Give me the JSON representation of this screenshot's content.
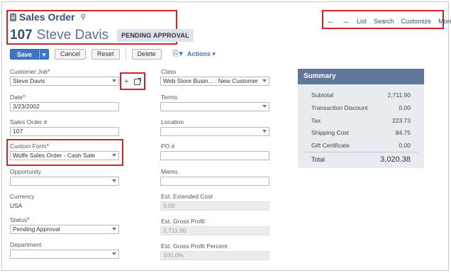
{
  "header": {
    "page_title": "Sales Order",
    "record_number": "107",
    "record_name": "Steve Davis",
    "status_badge": "PENDING APPROVAL"
  },
  "nav": {
    "back_icon": "arrow-left-icon",
    "forward_icon": "arrow-right-icon",
    "list": "List",
    "search": "Search",
    "customize": "Customize",
    "more": "More"
  },
  "toolbar": {
    "save": "Save",
    "cancel": "Cancel",
    "reset": "Reset",
    "delete": "Delete",
    "actions": "Actions"
  },
  "left_fields": {
    "customer_job": {
      "label": "Customer:Job",
      "value": "Steve Davis"
    },
    "date": {
      "label": "Date",
      "value": "3/23/2002"
    },
    "sales_order_num": {
      "label": "Sales Order #",
      "value": "107"
    },
    "custom_form": {
      "label": "Custom Form",
      "value": "Wolfe Sales Order - Cash Sale"
    },
    "opportunity": {
      "label": "Opportunity",
      "value": ""
    },
    "currency": {
      "label": "Currency",
      "value": "USA"
    },
    "status": {
      "label": "Status",
      "value": "Pending Approval"
    },
    "department": {
      "label": "Department",
      "value": ""
    }
  },
  "right_fields": {
    "class": {
      "label": "Class",
      "value": "Web Store Busin... : New Customer"
    },
    "terms": {
      "label": "Terms",
      "value": ""
    },
    "location": {
      "label": "Location",
      "value": ""
    },
    "po_num": {
      "label": "PO #",
      "value": ""
    },
    "memo": {
      "label": "Memo",
      "value": ""
    },
    "est_extended_cost": {
      "label": "Est. Extended Cost",
      "value": "0.00"
    },
    "est_gross_profit": {
      "label": "Est. Gross Profit",
      "value": "2,711.90"
    },
    "est_gross_profit_percent": {
      "label": "Est. Gross Profit Percent",
      "value": "100.0%"
    }
  },
  "summary": {
    "title": "Summary",
    "rows": [
      {
        "label": "Subtotal",
        "value": "2,711.90"
      },
      {
        "label": "Transaction Discount",
        "value": "0.00"
      },
      {
        "label": "Tax",
        "value": "223.73"
      },
      {
        "label": "Shipping Cost",
        "value": "84.75"
      },
      {
        "label": "Gift Certificate",
        "value": "0.00"
      }
    ],
    "total_label": "Total",
    "total_value": "3,020.38"
  },
  "colors": {
    "highlight_border": "#d0242b",
    "accent": "#3d76c9",
    "summary_header": "#607799"
  }
}
